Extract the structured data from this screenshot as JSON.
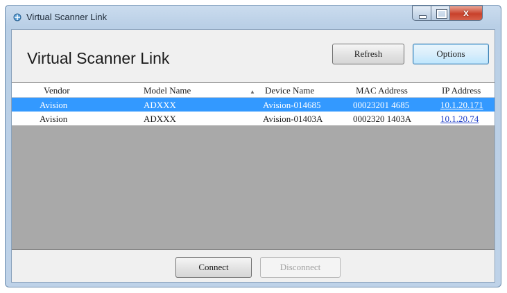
{
  "window": {
    "title": "Virtual Scanner Link",
    "close_glyph": "x"
  },
  "header": {
    "heading": "Virtual Scanner Link",
    "refresh_label": "Refresh",
    "options_label": "Options"
  },
  "table": {
    "columns": [
      "Vendor",
      "Model Name",
      "Device Name",
      "MAC Address",
      "IP Address"
    ],
    "sort_column": "Device Name",
    "sort_icon": "sort-ascending-icon",
    "rows": [
      {
        "vendor": "Avision",
        "model": "ADXXX",
        "device": "Avision-014685",
        "mac": "00023201 4685",
        "ip": "10.1.20.171",
        "selected": true
      },
      {
        "vendor": "Avision",
        "model": "ADXXX",
        "device": "Avision-01403A",
        "mac": "0002320 1403A",
        "ip": "10.1.20.74",
        "selected": false
      }
    ]
  },
  "footer": {
    "connect_label": "Connect",
    "disconnect_label": "Disconnect"
  },
  "colors": {
    "selection": "#3399ff",
    "link": "#1c3cc8",
    "empty_area": "#a9a9a9"
  }
}
